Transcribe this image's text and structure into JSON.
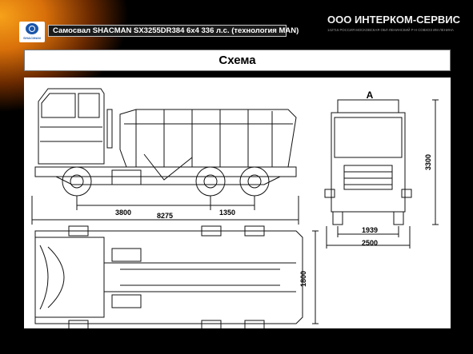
{
  "header": {
    "logo_text": "SHACMAN",
    "title": "Самосвал SHACMAN SX3255DR384 6x4 336 л.с. (технология MAN)",
    "company_name": "ООО ИНТЕРКОМ-СЕРВИС",
    "company_address": "142715 РОССИЯ МОСКОВСКАЯ ОБЛ ЛЕНИНСКИЙ Р-Н СОВХОЗ ИМ ЛЕНИНА"
  },
  "section": {
    "title": "Схема"
  },
  "drawing": {
    "view_label": "A",
    "dimensions": {
      "wheelbase_front": "3800",
      "wheelbase_rear": "1350",
      "overall_length": "8275",
      "height": "3300",
      "track": "1939",
      "overall_width": "2500",
      "frame_width": "1800"
    }
  }
}
